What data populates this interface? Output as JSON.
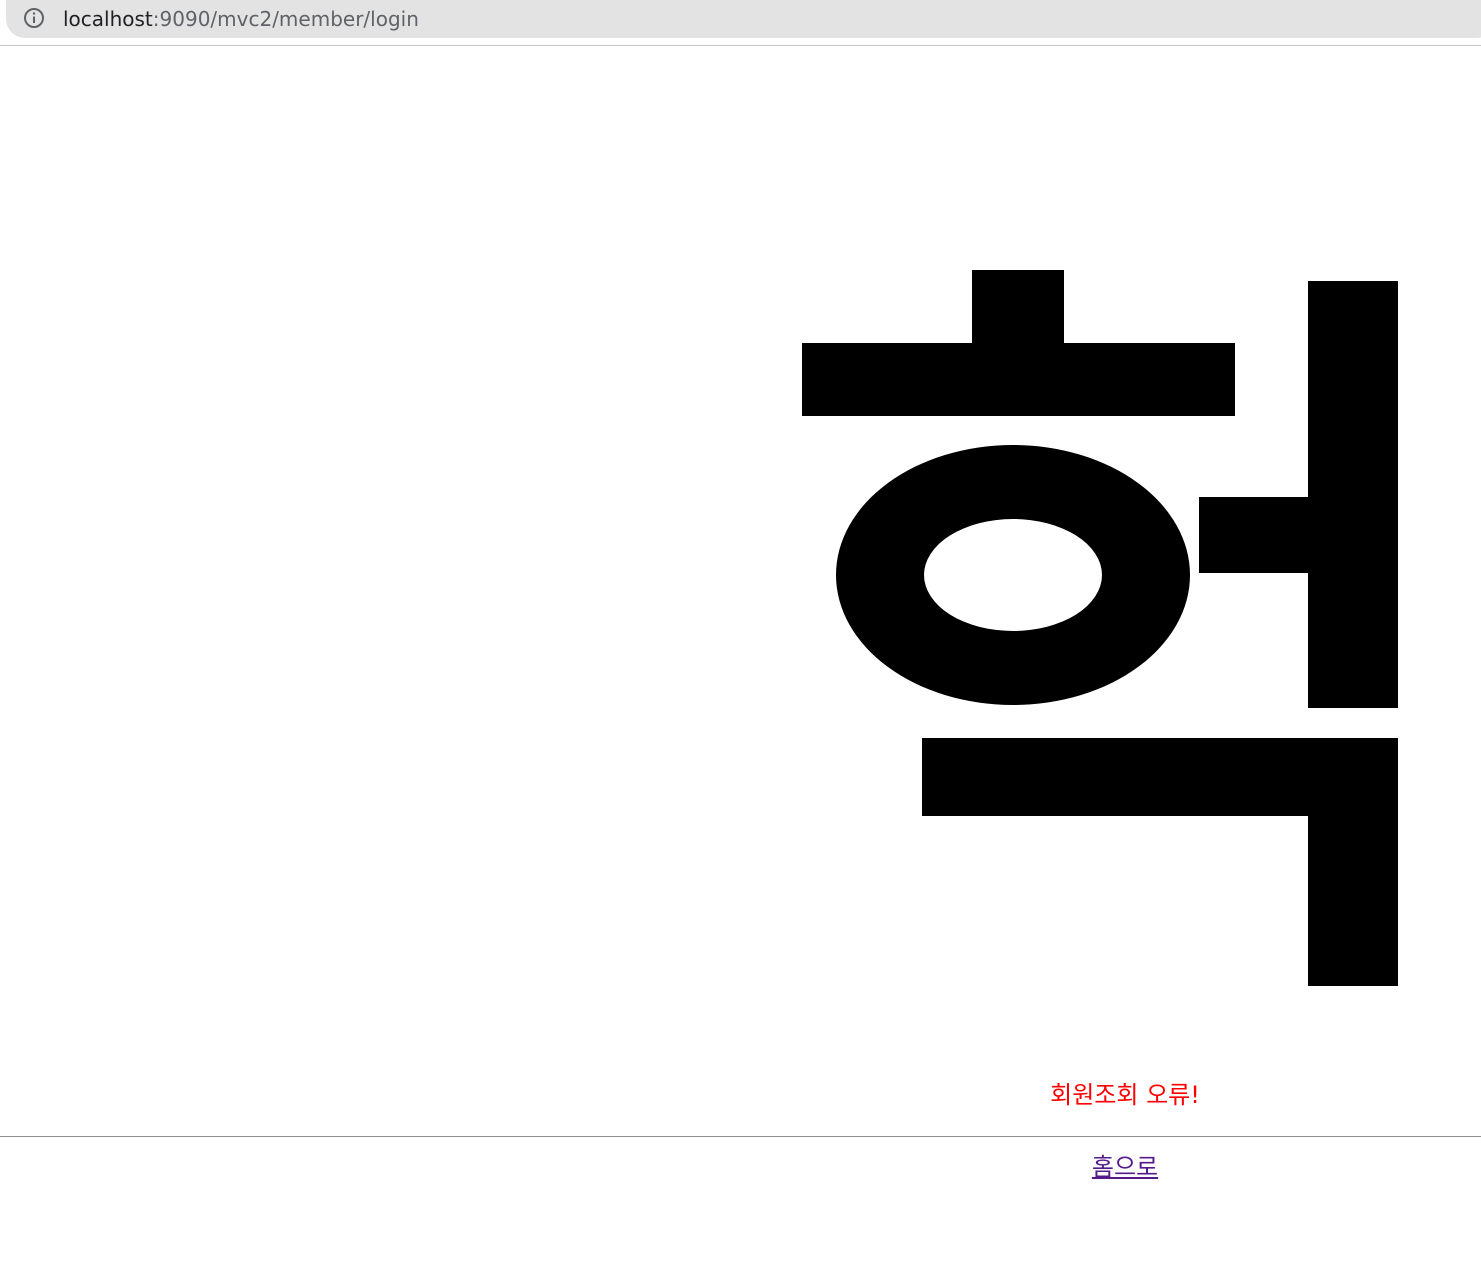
{
  "browser": {
    "url_host": "localhost",
    "url_path": ":9090/mvc2/member/login",
    "site_info_icon": "info-circle-icon"
  },
  "main": {
    "big_glyph": "헉",
    "error_message": "회원조회 오류!",
    "home_link": "홈으로",
    "error_color": "#ff0000",
    "visited_link_color": "#551a8b"
  }
}
